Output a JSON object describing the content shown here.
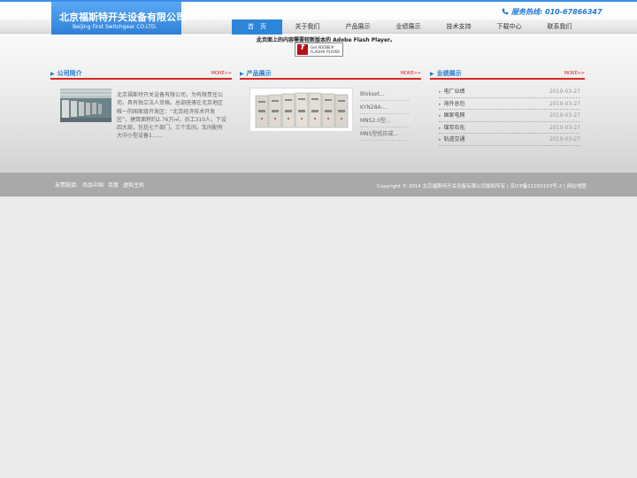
{
  "header": {
    "company_cn": "北京福斯特开关设备有限公司",
    "company_en": "Beijing  First Switchgear CO.LTD.",
    "hotline_label": "服务热线:",
    "hotline_number": "010-67866347",
    "accent_color": "#2d85d9"
  },
  "nav": {
    "items": [
      {
        "label": "首　页",
        "active": true
      },
      {
        "label": "关于我们"
      },
      {
        "label": "产品展示"
      },
      {
        "label": "业绩展示"
      },
      {
        "label": "技术支持"
      },
      {
        "label": "下载中心"
      },
      {
        "label": "联系我们"
      }
    ]
  },
  "flash": {
    "message": "此页面上的内容需要较新版本的 Adobe Flash Player。",
    "badge_line1": "Get ADOBE®",
    "badge_line2": "FLASH® PLAYER"
  },
  "about": {
    "title": "公司简介",
    "more": "MORE>>",
    "text": "北京福斯特开关设备有限公司，为有限责任公司，具有独立法人资格。总部座落在北京地区唯一的国家级开发区：“北京经济技术开发区”，建筑面积约2.76万㎡，员工310人，下设四大部，包括七个部门，三个车间。车间配有大中小型设备1……"
  },
  "products": {
    "title": "产品展示",
    "more": "MORE>>",
    "items": [
      "Blokset...",
      "KYN28A-...",
      "MNS2.0型...",
      "MNS型低压成..."
    ]
  },
  "performance": {
    "title": "业绩展示",
    "more": "MORE>>",
    "items": [
      {
        "name": "电厂业绩",
        "date": "2019-03-27"
      },
      {
        "name": "海外总包",
        "date": "2019-03-27"
      },
      {
        "name": "国家电网",
        "date": "2019-03-27"
      },
      {
        "name": "煤炭石化",
        "date": "2019-03-27"
      },
      {
        "name": "轨道交通",
        "date": "2019-03-27"
      }
    ]
  },
  "footer": {
    "links_label": "友情链接:",
    "links": [
      "尚品中国",
      "百度",
      "虚拟主机"
    ],
    "copyright": "Copyright © 2014 北京福斯特开关设备有限公司版权所有 | 京ICP备11032103号-2 | 网站地图"
  }
}
